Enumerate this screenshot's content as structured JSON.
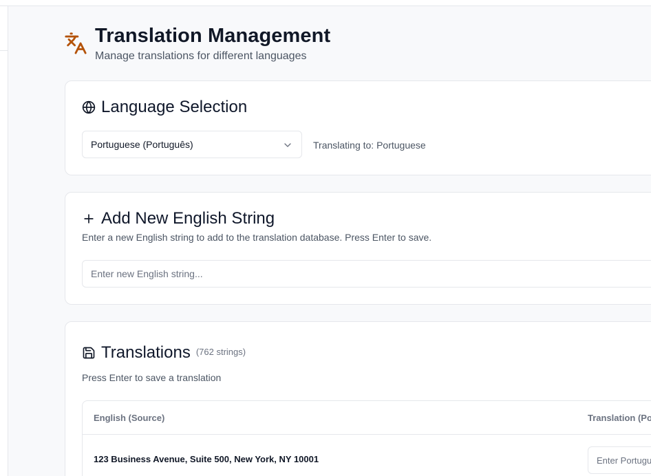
{
  "header": {
    "title": "Translation Management",
    "subtitle": "Manage translations for different languages",
    "icon": "translate-icon",
    "accent": "#b45309"
  },
  "language_selection": {
    "title": "Language Selection",
    "icon": "globe-icon",
    "selected_language": "Portuguese (Português)",
    "translating_to": "Translating to: Portuguese"
  },
  "add_string": {
    "title": "Add New English String",
    "icon": "plus-icon",
    "description": "Enter a new English string to add to the translation database. Press Enter to save.",
    "input_placeholder": "Enter new English string..."
  },
  "translations": {
    "title": "Translations",
    "icon": "save-icon",
    "count": "(762 strings)",
    "description": "Press Enter to save a translation",
    "columns": [
      "English (Source)",
      "Translation (Portuguese)"
    ],
    "rows": [
      {
        "source": "123 Business Avenue, Suite 500, New York, NY 10001",
        "translation_placeholder": "Enter Portuguese translation..."
      }
    ]
  }
}
